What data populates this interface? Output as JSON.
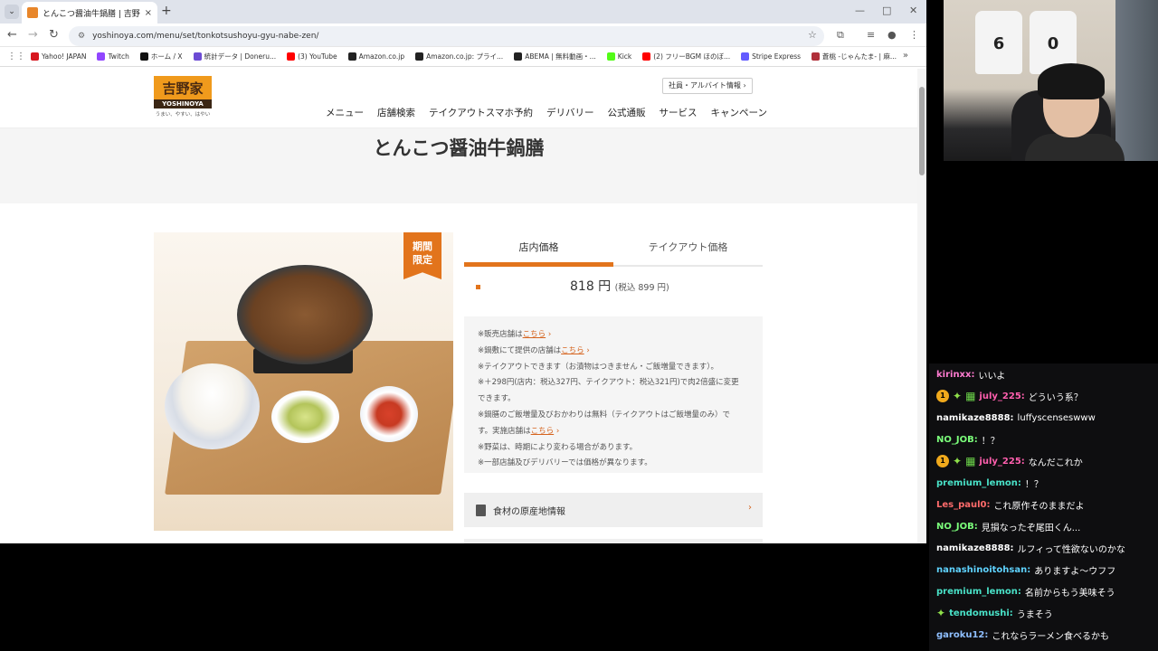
{
  "browser": {
    "tab_title": "とんこつ醤油牛鍋膳 | 吉野家公式",
    "tab_close": "×",
    "new_tab": "+",
    "url": "yoshinoya.com/menu/set/tonkotsushoyu-gyu-nabe-zen/",
    "bookmarks": [
      {
        "label": "Yahoo! JAPAN",
        "color": "#d7171f"
      },
      {
        "label": "Twitch",
        "color": "#9146ff"
      },
      {
        "label": "ホーム / X",
        "color": "#111111"
      },
      {
        "label": "統計データ | Doneru...",
        "color": "#6c4bd4"
      },
      {
        "label": "(3) YouTube",
        "color": "#ff0000"
      },
      {
        "label": "Amazon.co.jp",
        "color": "#222222"
      },
      {
        "label": "Amazon.co.jp: プライ...",
        "color": "#222222"
      },
      {
        "label": "ABEMA | 無料動画・...",
        "color": "#222222"
      },
      {
        "label": "Kick",
        "color": "#53fc18"
      },
      {
        "label": "(2) フリーBGM ほのぼ...",
        "color": "#ff0000"
      },
      {
        "label": "Stripe Express",
        "color": "#635bff"
      },
      {
        "label": "蒼桃 -じゃんたま- | 麻...",
        "color": "#b0303a"
      }
    ]
  },
  "site": {
    "logo_main": "吉野家",
    "logo_brand": "YOSHINOYA",
    "logo_tagline": "うまい、やすい、はやい",
    "recruit": "社員・アルバイト情報",
    "recruit_chev": "›",
    "nav": [
      "メニュー",
      "店舗検索",
      "テイクアウトスマホ予約",
      "デリバリー",
      "公式通販",
      "サービス",
      "キャンペーン"
    ],
    "title": "とんこつ醤油牛鍋膳",
    "badge_line1": "期間",
    "badge_line2": "限定"
  },
  "pricing": {
    "tab_instore": "店内価格",
    "tab_takeout": "テイクアウト価格",
    "price": "818 円",
    "price_tax": "(税込 899 円)"
  },
  "notes": {
    "n1_pre": "※販売店舗は",
    "n1_link": "こちら",
    "n2_pre": "※鍋敷にて提供の店舗は",
    "n2_link": "こちら",
    "n3": "※テイクアウトできます（お漬物はつきません・ご飯増量できます）。",
    "n4": "※＋298円(店内：税込327円、テイクアウト：税込321円)で肉2倍盛に変更",
    "n4b": "できます。",
    "n5": "※鍋膳のご飯増量及びおかわりは無料（テイクアウトはご飯増量のみ）で",
    "n5b_pre": "す。実施店舗は",
    "n5b_link": "こちら",
    "n6": "※野菜は、時期により変わる場合があります。",
    "n7": "※一部店舗及びデリバリーでは価格が異なります。",
    "chev": "›"
  },
  "origin_label": "食材の原産地情報",
  "origin_chev": "›",
  "webcam": {
    "jersey_left": "6",
    "jersey_right": "0"
  },
  "chat": [
    {
      "user": "kirinxx",
      "color": "#ff7bd0",
      "text": "いいよ",
      "badges": []
    },
    {
      "user": "july_225",
      "color": "#ff5fae",
      "text": "どういう系？",
      "badges": [
        "sub",
        "spark",
        "grn"
      ]
    },
    {
      "user": "namikaze8888",
      "color": "#ffffff",
      "text": "luffyscenseswww",
      "badges": []
    },
    {
      "user": "NO_JOB",
      "color": "#7bff7b",
      "text": "！？",
      "badges": []
    },
    {
      "user": "july_225",
      "color": "#ff5fae",
      "text": "なんだこれか",
      "badges": [
        "sub",
        "spark",
        "grn"
      ]
    },
    {
      "user": "premium_lemon",
      "color": "#49e2c8",
      "text": "！？",
      "badges": []
    },
    {
      "user": "Les_paul0",
      "color": "#ff6b6b",
      "text": "これ原作そのままだよ",
      "badges": []
    },
    {
      "user": "NO_JOB",
      "color": "#7bff7b",
      "text": "見損なったぞ尾田くん...",
      "badges": []
    },
    {
      "user": "namikaze8888",
      "color": "#ffffff",
      "text": "ルフィって性欲ないのかな",
      "badges": []
    },
    {
      "user": "nanashinoitohsan",
      "color": "#5fd3ff",
      "text": "ありますよ～ウフフ",
      "badges": []
    },
    {
      "user": "premium_lemon",
      "color": "#49e2c8",
      "text": "名前からもう美味そう",
      "badges": []
    },
    {
      "user": "tendomushi",
      "color": "#49e2c8",
      "text": "うまそう",
      "badges": [
        "spark"
      ]
    },
    {
      "user": "garoku12",
      "color": "#8fbfff",
      "text": "これならラーメン食べるかも",
      "badges": []
    }
  ]
}
